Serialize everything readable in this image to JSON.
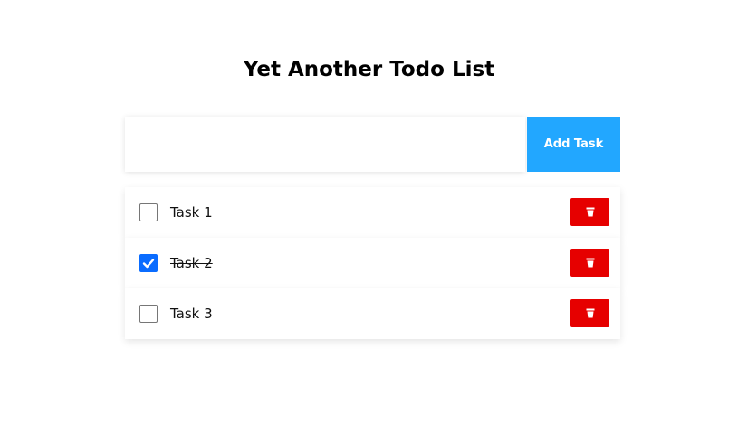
{
  "app": {
    "title": "Yet Another Todo List"
  },
  "input": {
    "value": "",
    "placeholder": ""
  },
  "add_button": {
    "label": "Add Task",
    "color": "#22a7ff"
  },
  "tasks": [
    {
      "label": "Task 1",
      "completed": false
    },
    {
      "label": "Task 2",
      "completed": true
    },
    {
      "label": "Task 3",
      "completed": false
    }
  ],
  "delete_button": {
    "icon": "trash-icon",
    "color": "#e60000"
  },
  "checkbox": {
    "checked_color": "#0a6cff"
  }
}
